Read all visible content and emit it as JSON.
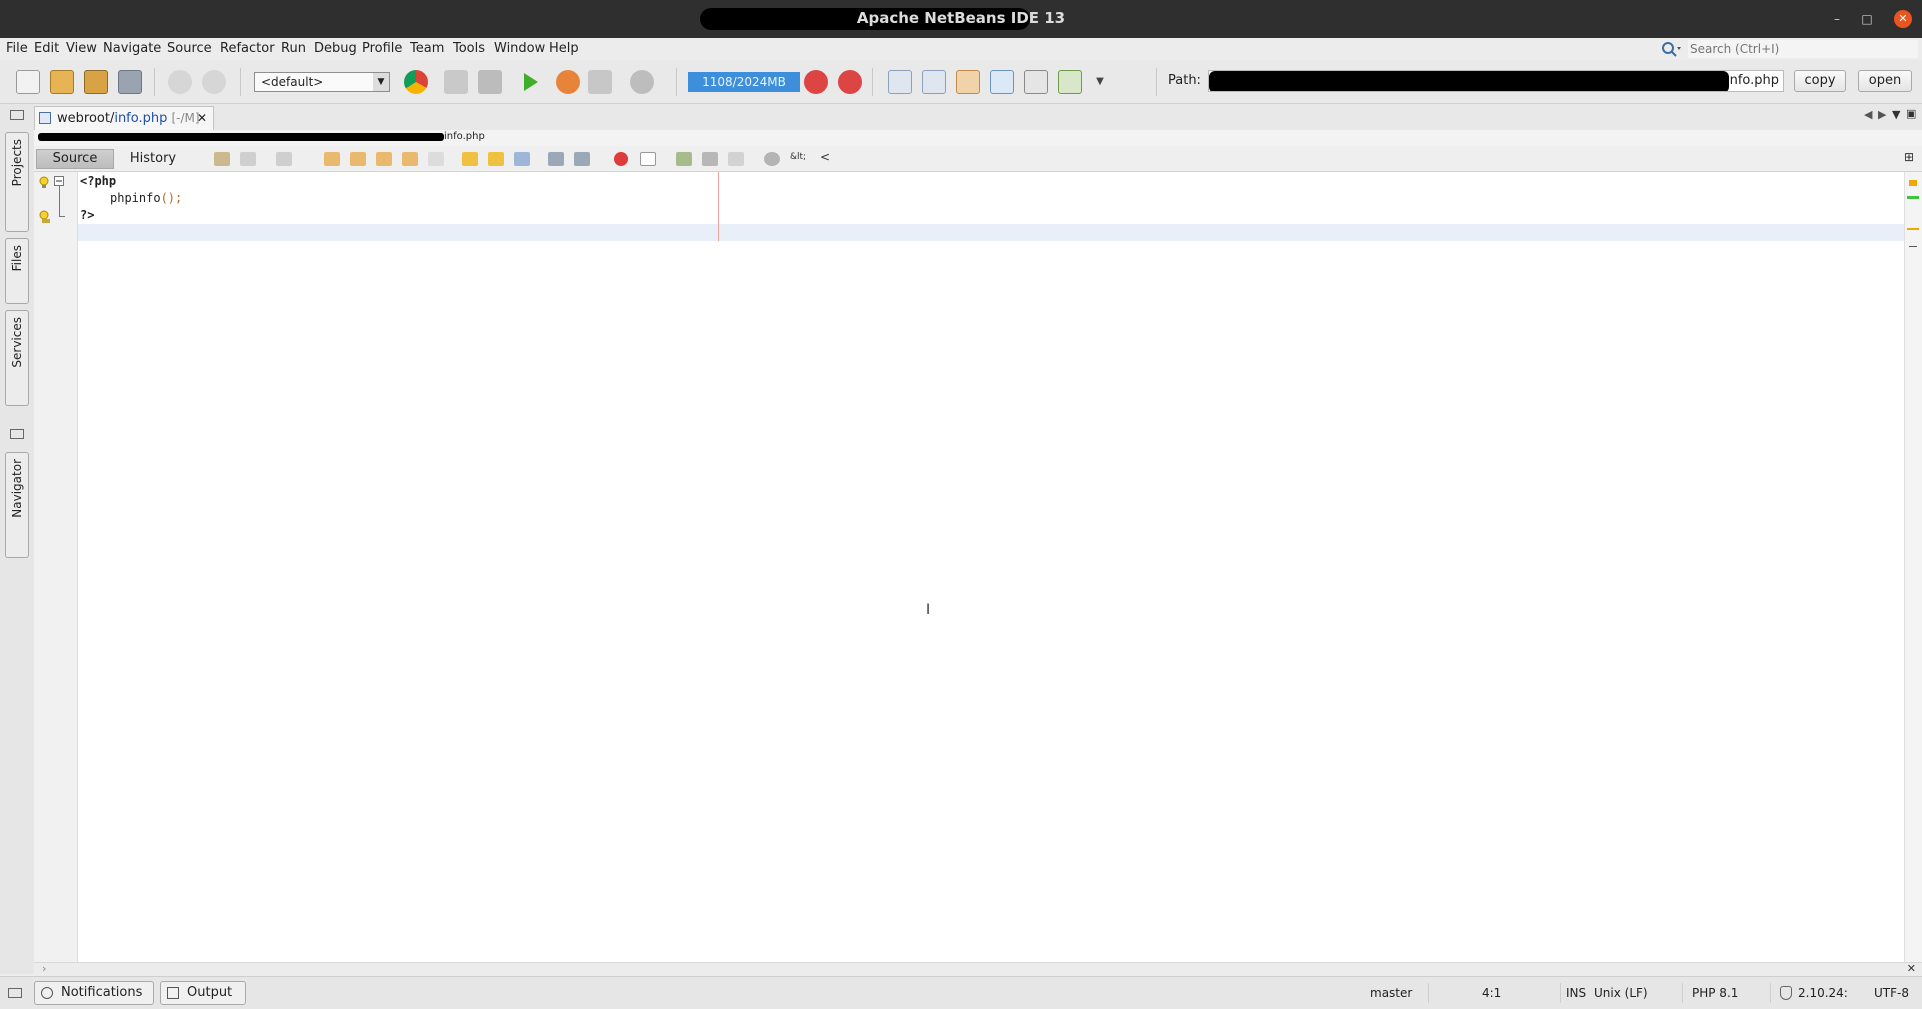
{
  "window": {
    "title": "Apache NetBeans IDE 13",
    "controls": [
      "minimize",
      "maximize",
      "close"
    ]
  },
  "menu": {
    "items": [
      "File",
      "Edit",
      "View",
      "Navigate",
      "Source",
      "Refactor",
      "Run",
      "Debug",
      "Profile",
      "Team",
      "Tools",
      "Window",
      "Help"
    ]
  },
  "search": {
    "placeholder": "Search (Ctrl+I)"
  },
  "toolbar": {
    "config_value": "<default>",
    "memory": "1108/2024MB",
    "path_label": "Path:",
    "path_value": "nfo.php",
    "copy_label": "copy",
    "open_label": "open"
  },
  "side_tabs": {
    "projects": "Projects",
    "files": "Files",
    "services": "Services",
    "navigator": "Navigator"
  },
  "editor": {
    "tab_title_prefix": "webroot/",
    "tab_title_file": "info.php",
    "tab_state": "[-/M]",
    "breadcrumb_tail": "info.php",
    "source_label": "Source",
    "history_label": "History",
    "entity_hint": "&lt;",
    "entity_char": "<",
    "code": {
      "line1": "<?php",
      "line2_fn": "phpinfo",
      "line2_rest": "();",
      "line3": "?>"
    }
  },
  "status": {
    "notifications_label": "Notifications",
    "output_label": "Output",
    "branch": "master",
    "caret": "4:1",
    "mode": "INS",
    "line_ending": "Unix (LF)",
    "php_version": "PHP 8.1",
    "version_info": "2.10.24:",
    "encoding": "UTF-8"
  },
  "colors": {
    "titlebar": "#2f2f2f",
    "close_button": "#e9541f",
    "memory_bar": "#3d8fdc",
    "php_tag": "#000000",
    "paren": "#b06a2a"
  }
}
